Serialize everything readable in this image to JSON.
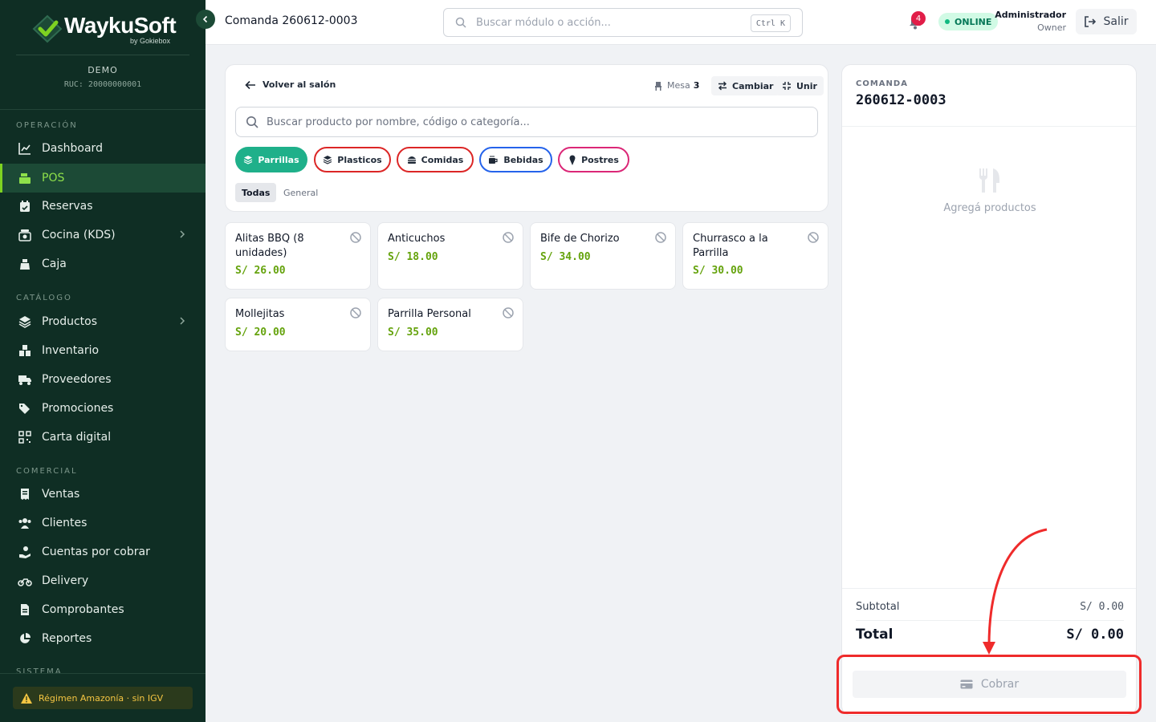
{
  "brand": {
    "name": "WaykuSoft",
    "byline": "by Gokiebox",
    "accent_color": "#7ed321",
    "sidebar_bg": "#0f2e24"
  },
  "tenant": {
    "name": "DEMO",
    "ruc": "RUC: 20000000001"
  },
  "sidebar": {
    "sections": [
      {
        "label": "OPERACIÓN"
      },
      {
        "label": "CATÁLOGO"
      },
      {
        "label": "COMERCIAL"
      },
      {
        "label": "SISTEMA"
      }
    ],
    "items": [
      {
        "label": "Dashboard",
        "icon": "chart-line-icon"
      },
      {
        "label": "POS",
        "icon": "cash-register-icon",
        "active": true
      },
      {
        "label": "Reservas",
        "icon": "calendar-check-icon"
      },
      {
        "label": "Cocina (KDS)",
        "icon": "kitchen-icon",
        "has_submenu": true
      },
      {
        "label": "Caja",
        "icon": "cash-box-icon"
      },
      {
        "label": "Productos",
        "icon": "layers-icon",
        "has_submenu": true
      },
      {
        "label": "Inventario",
        "icon": "boxes-icon"
      },
      {
        "label": "Proveedores",
        "icon": "truck-icon"
      },
      {
        "label": "Promociones",
        "icon": "tags-icon"
      },
      {
        "label": "Carta digital",
        "icon": "qr-code-icon"
      },
      {
        "label": "Ventas",
        "icon": "receipt-icon"
      },
      {
        "label": "Clientes",
        "icon": "users-icon"
      },
      {
        "label": "Cuentas por cobrar",
        "icon": "hand-coin-icon"
      },
      {
        "label": "Delivery",
        "icon": "motorcycle-icon"
      },
      {
        "label": "Comprobantes",
        "icon": "file-invoice-icon"
      },
      {
        "label": "Reportes",
        "icon": "pie-chart-icon"
      }
    ],
    "regimen": "Régimen Amazonía · sin IGV"
  },
  "topbar": {
    "title": "Comanda 260612-0003",
    "search_placeholder": "Buscar módulo o acción...",
    "shortcut": "Ctrl K",
    "notifications_count": "4",
    "status": "ONLINE",
    "user_name": "Administrador",
    "user_role": "Owner",
    "logout_label": "Salir"
  },
  "pos": {
    "back_label": "Volver al salón",
    "mesa_label": "Mesa",
    "mesa_number": "3",
    "change_label": "Cambiar",
    "join_label": "Unir",
    "search_placeholder": "Buscar producto por nombre, código o categoría...",
    "categories": [
      {
        "label": "Parrillas",
        "color": "#1fb08a",
        "selected": true
      },
      {
        "label": "Plasticos",
        "color": "#dc2626"
      },
      {
        "label": "Comidas",
        "color": "#dc2626"
      },
      {
        "label": "Bebidas",
        "color": "#2563eb"
      },
      {
        "label": "Postres",
        "color": "#db2777"
      }
    ],
    "subfilters": [
      {
        "label": "Todas",
        "selected": true
      },
      {
        "label": "General"
      }
    ],
    "products": [
      {
        "name": "Alitas BBQ (8 unidades)",
        "price": "S/ 26.00"
      },
      {
        "name": "Anticuchos",
        "price": "S/ 18.00"
      },
      {
        "name": "Bife de Chorizo",
        "price": "S/ 34.00"
      },
      {
        "name": "Churrasco a la Parrilla",
        "price": "S/ 30.00"
      },
      {
        "name": "Mollejitas",
        "price": "S/ 20.00"
      },
      {
        "name": "Parrilla Personal",
        "price": "S/ 35.00"
      }
    ]
  },
  "order": {
    "label": "COMANDA",
    "number": "260612-0003",
    "empty_text": "Agregá productos",
    "subtotal_label": "Subtotal",
    "subtotal_value": "S/ 0.00",
    "total_label": "Total",
    "total_value": "S/ 0.00",
    "charge_label": "Cobrar"
  },
  "annotation": {
    "color": "#ef2b2b"
  }
}
